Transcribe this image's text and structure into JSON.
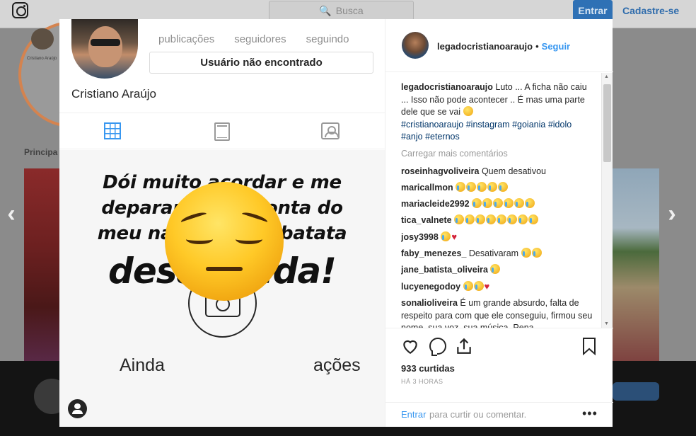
{
  "topbar": {
    "search_placeholder": "Busca",
    "login_label": "Entrar",
    "signup_label": "Cadastre-se"
  },
  "background": {
    "section_label": "Principa",
    "avatar_caption": "Cristiano Araújo"
  },
  "profile": {
    "stats": [
      "publicações",
      "seguidores",
      "seguindo"
    ],
    "not_found": "Usuário não encontrado",
    "name": "Cristiano Araújo",
    "no_posts_a": "Ainda",
    "no_posts_b": "ações"
  },
  "overlay": {
    "line1": "Dói muito acordar e me",
    "line2": "deparar com a conta do",
    "line3": "meu narizinho de batata",
    "big": "desativada!"
  },
  "post": {
    "username": "legadocristianoaraujo",
    "dot": "•",
    "follow_label": "Seguir",
    "caption_user": "legadocristianoaraujo",
    "caption_text": "Luto ... A ficha não caiu ... Isso não pode acontecer .. É mas uma parte dele que se vai",
    "hashtags": [
      "#cristianoaraujo",
      "#instagram",
      "#goiania",
      "#idolo",
      "#anjo",
      "#eternos"
    ],
    "load_more": "Carregar mais comentários",
    "comments": [
      {
        "user": "roseinhagvoliveira",
        "text": "Quem desativou",
        "emojis": 0,
        "hearts": 0
      },
      {
        "user": "maricallmon",
        "text": "",
        "emojis": 5,
        "hearts": 0
      },
      {
        "user": "mariacleide2992",
        "text": "",
        "emojis": 6,
        "hearts": 0
      },
      {
        "user": "tica_valnete",
        "text": "",
        "emojis": 8,
        "hearts": 0
      },
      {
        "user": "josy3998",
        "text": "",
        "emojis": 1,
        "hearts": 1
      },
      {
        "user": "faby_menezes_",
        "text": "Desativaram",
        "emojis": 2,
        "hearts": 0
      },
      {
        "user": "jane_batista_oliveira",
        "text": "",
        "emojis": 1,
        "hearts": 0
      },
      {
        "user": "lucyenegodoy",
        "text": "",
        "emojis": 2,
        "hearts": 1
      },
      {
        "user": "sonalioliveira",
        "text": "É um grande absurdo, falta de respeito para com que ele conseguiu, firmou seu nome, sua voz, sua música. Pena",
        "emojis": 0,
        "hearts": 0
      }
    ],
    "likes": "933 curtidas",
    "time": "HÁ 3 HORAS",
    "login_link": "Entrar",
    "login_text": "para curtir ou comentar.",
    "more_label": "•••"
  },
  "icons": {
    "search": "search-icon",
    "heart": "heart-icon",
    "comment": "comment-icon",
    "share": "share-icon",
    "save": "bookmark-icon"
  },
  "colors": {
    "accent": "#3897f0",
    "hashtag": "#003569",
    "heart": "#d3233a"
  }
}
